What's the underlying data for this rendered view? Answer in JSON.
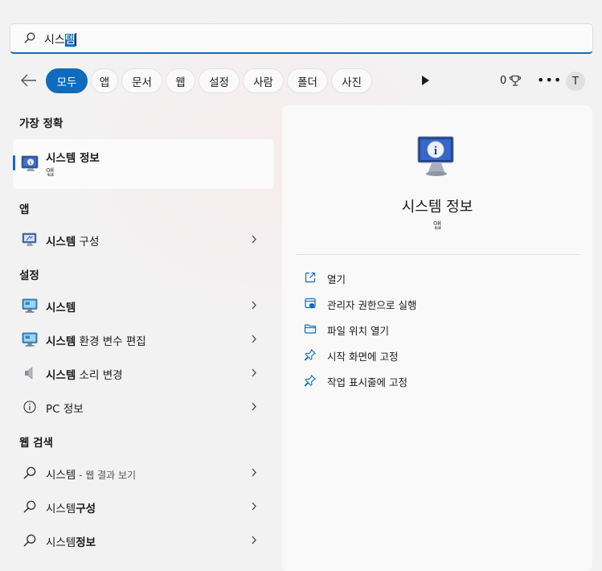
{
  "search": {
    "query_plain": "시스",
    "query_selected": "템"
  },
  "filters": {
    "chips": [
      {
        "label": "모두",
        "active": true
      },
      {
        "label": "앱",
        "active": false
      },
      {
        "label": "문서",
        "active": false
      },
      {
        "label": "웹",
        "active": false
      },
      {
        "label": "설정",
        "active": false
      },
      {
        "label": "사람",
        "active": false
      },
      {
        "label": "폴더",
        "active": false
      },
      {
        "label": "사진",
        "active": false
      }
    ],
    "points": "0",
    "avatar_initial": "T"
  },
  "results": {
    "best_match_title": "가장 정확",
    "best_match": {
      "title": "시스템 정보",
      "subtitle": "앱",
      "icon": "system-info-icon"
    },
    "apps_title": "앱",
    "apps": [
      {
        "bold": "시스템",
        "rest": " 구성",
        "icon": "system-config-icon"
      }
    ],
    "settings_title": "설정",
    "settings": [
      {
        "bold": "시스템",
        "rest": "",
        "icon": "monitor-settings-icon"
      },
      {
        "bold": "시스템",
        "rest": " 환경 변수 편집",
        "icon": "monitor-settings-icon"
      },
      {
        "bold": "시스템",
        "rest": " 소리 변경",
        "icon": "speaker-icon"
      },
      {
        "bold": "",
        "rest": "PC 정보",
        "icon": "info-circle-icon"
      }
    ],
    "web_title": "웹 검색",
    "web": [
      {
        "bold": "",
        "plain": "시스템",
        "muted": " - 웹 결과 보기"
      },
      {
        "bold": "구성",
        "plain": "시스템",
        "muted": ""
      },
      {
        "bold": "정보",
        "plain": "시스템",
        "muted": ""
      }
    ]
  },
  "detail": {
    "title": "시스템 정보",
    "subtitle": "앱",
    "actions": [
      {
        "label": "열기",
        "icon": "open-external-icon"
      },
      {
        "label": "관리자 권한으로 실행",
        "icon": "shield-admin-icon"
      },
      {
        "label": "파일 위치 열기",
        "icon": "folder-icon"
      },
      {
        "label": "시작 화면에 고정",
        "icon": "pin-icon"
      },
      {
        "label": "작업 표시줄에 고정",
        "icon": "pin-icon"
      }
    ]
  },
  "colors": {
    "accent": "#0f6cbd",
    "background": "#f2f2f3",
    "panel": "#f9f9f9"
  }
}
